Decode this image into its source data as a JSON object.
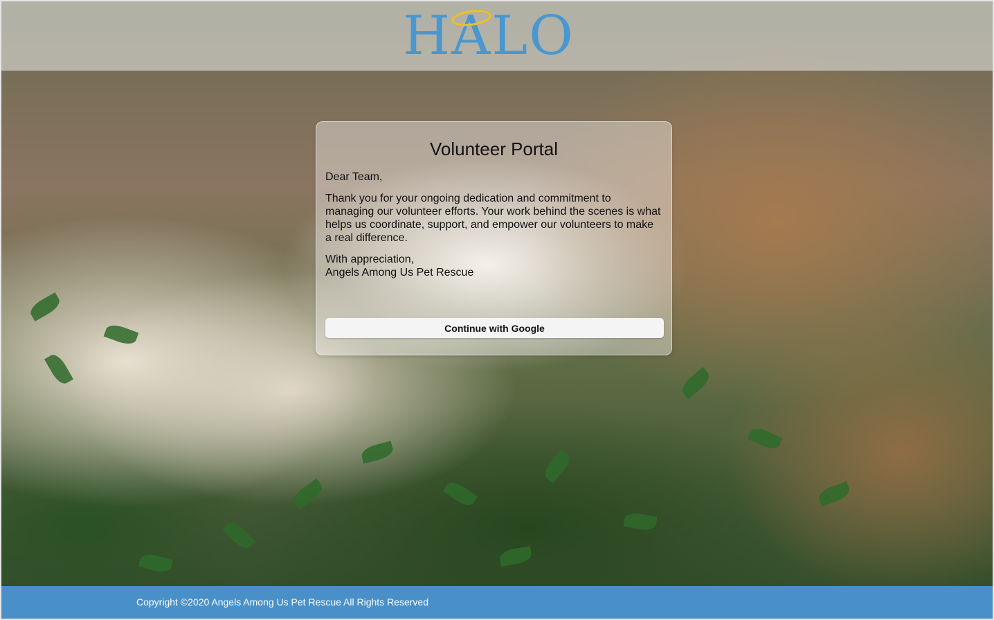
{
  "header": {
    "logo_text": "HALO",
    "logo_color": "#4a97cf",
    "halo_ring_color": "#f0c023"
  },
  "card": {
    "title": "Volunteer Portal",
    "greeting": "Dear Team,",
    "body": "Thank you for your ongoing dedication and commitment to managing our volunteer efforts. Your work behind the scenes is what helps us coordinate, support, and empower our volunteers to make a real difference.",
    "closing_line1": "With appreciation,",
    "closing_line2": "Angels Among Us Pet Rescue",
    "button_label": "Continue with Google"
  },
  "footer": {
    "copyright": "Copyright ©2020 Angels Among Us Pet Rescue All Rights Reserved",
    "background_color": "#4a90c8"
  }
}
